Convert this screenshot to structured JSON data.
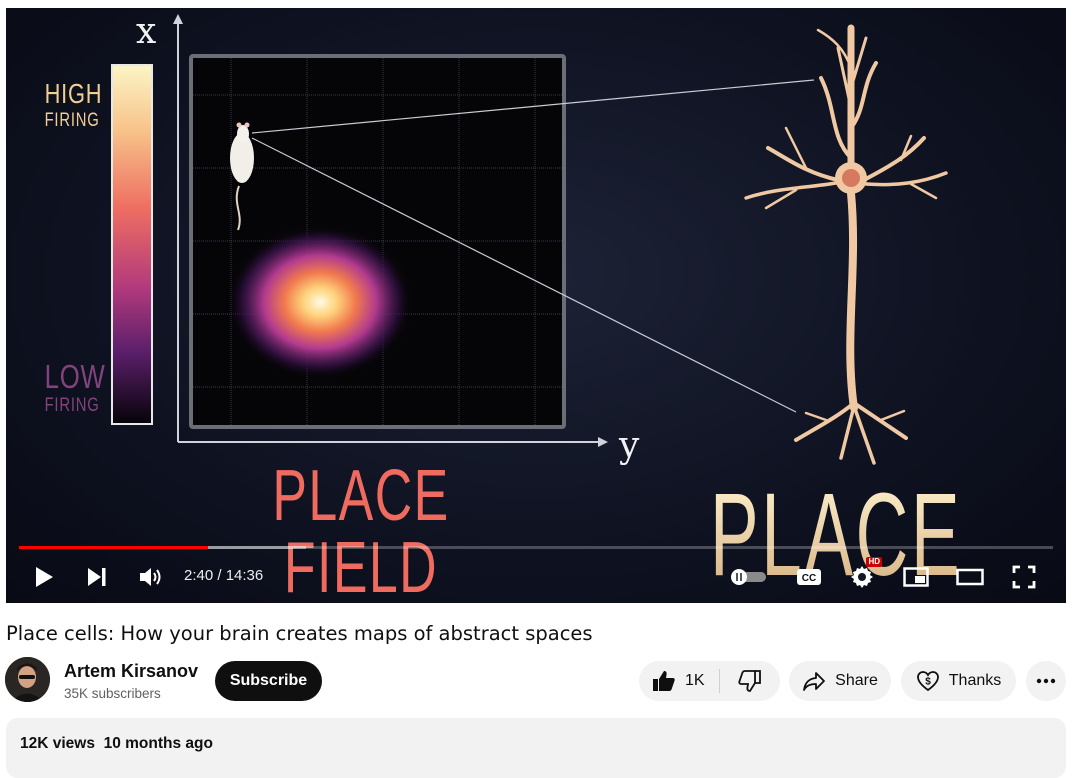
{
  "video_frame": {
    "axis_x": "x",
    "axis_y": "y",
    "legend_high_line1": "HIGH",
    "legend_high_line2": "FIRING",
    "legend_low_line1": "LOW",
    "legend_low_line2": "FIRING",
    "place_field_text": "PLACE FIELD",
    "place_cell_text": "PLACE CELL"
  },
  "player": {
    "time_display": "2:40 / 14:36",
    "progress_played_fraction": 0.183,
    "progress_buffered_fraction": 0.278,
    "hd_badge": "HD",
    "cc_label": "CC",
    "colors": {
      "progress_played": "#ff0000",
      "controls": "#ffffff"
    }
  },
  "video": {
    "title": "Place cells: How your brain creates maps of abstract spaces"
  },
  "channel": {
    "name": "Artem Kirsanov",
    "subscribers": "35K subscribers",
    "subscribe_label": "Subscribe"
  },
  "actions": {
    "like_count": "1K",
    "share_label": "Share",
    "thanks_label": "Thanks"
  },
  "description": {
    "views": "12K views",
    "date": "10 months ago"
  }
}
